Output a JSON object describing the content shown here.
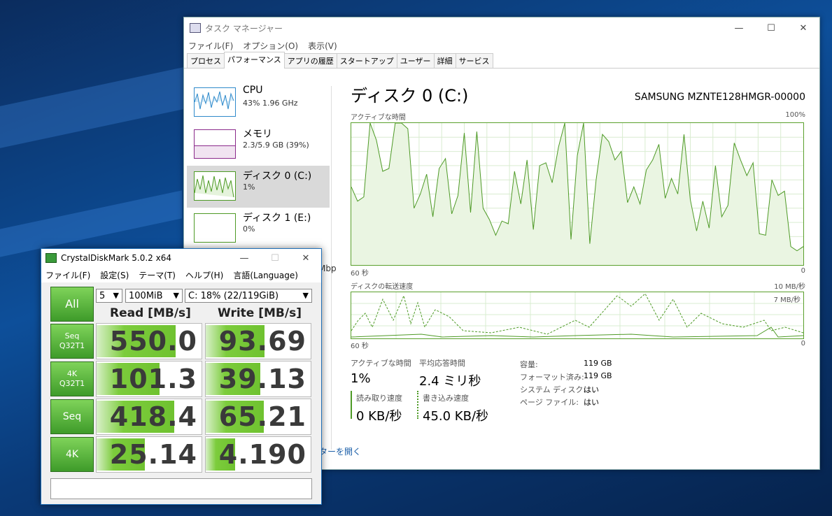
{
  "task_manager": {
    "title": "タスク マネージャー",
    "menu": [
      "ファイル(F)",
      "オプション(O)",
      "表示(V)"
    ],
    "tabs": [
      "プロセス",
      "パフォーマンス",
      "アプリの履歴",
      "スタートアップ",
      "ユーザー",
      "詳細",
      "サービス"
    ],
    "active_tab": "パフォーマンス",
    "sidebar": [
      {
        "name": "CPU",
        "sub": "43% 1.96 GHz"
      },
      {
        "name": "メモリ",
        "sub": "2.3/5.9 GB (39%)"
      },
      {
        "name": "ディスク 0 (C:)",
        "sub": "1%"
      },
      {
        "name": "ディスク 1 (E:)",
        "sub": "0%"
      }
    ],
    "sidebar_partial": "Mbp",
    "main": {
      "heading": "ディスク 0 (C:)",
      "model": "SAMSUNG MZNTE128HMGR-00000",
      "graph1_label": "アクティブな時間",
      "graph1_max": "100%",
      "graph1_left": "60 秒",
      "graph1_right": "0",
      "graph2_label": "ディスクの転送速度",
      "graph2_max": "10 MB/秒",
      "graph2_sub": "7 MB/秒",
      "graph2_left": "60 秒",
      "graph2_right": "0"
    },
    "stats": {
      "active_label": "アクティブな時間",
      "active_value": "1%",
      "resp_label": "平均応答時間",
      "resp_value": "2.4 ミリ秒",
      "read_label": "読み取り速度",
      "read_value": "0 KB/秒",
      "write_label": "書き込み速度",
      "write_value": "45.0 KB/秒",
      "props": [
        {
          "label": "容量:",
          "value": "119 GB"
        },
        {
          "label": "フォーマット済み:",
          "value": "119 GB"
        },
        {
          "label": "システム ディスク:",
          "value": "はい"
        },
        {
          "label": "ページ ファイル:",
          "value": "はい"
        }
      ]
    },
    "link_text": "ターを開く",
    "window_buttons": [
      "—",
      "☐",
      "✕"
    ],
    "active_time_series": [
      55,
      45,
      48,
      100,
      88,
      66,
      68,
      100,
      100,
      96,
      40,
      50,
      64,
      34,
      68,
      75,
      36,
      49,
      93,
      37,
      94,
      40,
      32,
      21,
      31,
      29,
      66,
      43,
      74,
      25,
      70,
      72,
      58,
      83,
      100,
      18,
      77,
      100,
      15,
      60,
      92,
      87,
      74,
      80,
      44,
      55,
      43,
      67,
      74,
      85,
      47,
      61,
      50,
      92,
      46,
      24,
      45,
      26,
      70,
      34,
      42,
      86,
      74,
      63,
      72,
      22,
      21,
      60,
      49,
      52,
      13,
      10,
      13
    ]
  },
  "crystaldiskmark": {
    "title": "CrystalDiskMark 5.0.2 x64",
    "menu": [
      "ファイル(F)",
      "設定(S)",
      "テーマ(T)",
      "ヘルプ(H)",
      "言語(Language)"
    ],
    "all_button": "All",
    "count_select": "5",
    "size_select": "100MiB",
    "drive_select": "C: 18% (22/119GiB)",
    "read_header": "Read [MB/s]",
    "write_header": "Write [MB/s]",
    "rows": [
      {
        "label": "Seq\nQ32T1",
        "read": "550.0",
        "write": "93.69",
        "read_fill": 0.75,
        "write_fill": 0.56
      },
      {
        "label": "4K\nQ32T1",
        "read": "101.3",
        "write": "39.13",
        "read_fill": 0.6,
        "write_fill": 0.52
      },
      {
        "label": "Seq",
        "read": "418.4",
        "write": "65.21",
        "read_fill": 0.74,
        "write_fill": 0.55
      },
      {
        "label": "4K",
        "read": "25.14",
        "write": "4.190",
        "read_fill": 0.46,
        "write_fill": 0.28
      }
    ]
  }
}
